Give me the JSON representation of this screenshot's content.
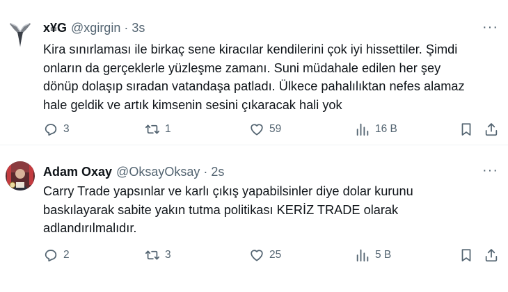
{
  "tweets": [
    {
      "name": "х¥G",
      "handle": "@xgirgin",
      "separator": "·",
      "time": "3s",
      "more": "···",
      "text": "Kira sınırlaması ile birkaç sene kiracılar kendilerini çok iyi hissettiler. Şimdi\nonların da gerçeklerle yüzleşme zamanı. Suni müdahale edilen her şey\ndönüp dolaşıp sıradan vatandaşa patladı. Ülkece pahalılıktan nefes alamaz\nhale geldik ve artık kimsenin sesini çıkaracak hali yok",
      "replies": "3",
      "retweets": "1",
      "likes": "59",
      "views": "16 B"
    },
    {
      "name": "Adam Oxay",
      "handle": "@OksayOksay",
      "separator": "·",
      "time": "2s",
      "more": "···",
      "text": "Carry Trade yapsınlar ve karlı çıkış yapabilsinler diye dolar kurunu\nbaskılayarak sabite yakın tutma politikası KERİZ TRADE olarak\nadlandırılmalıdır.",
      "replies": "2",
      "retweets": "3",
      "likes": "25",
      "views": "5 B"
    }
  ],
  "icons": {
    "reply": "reply-icon",
    "retweet": "retweet-icon",
    "like": "heart-icon",
    "views": "views-icon",
    "bookmark": "bookmark-icon",
    "share": "share-icon",
    "more": "more-icon"
  },
  "colors": {
    "text": "#0f1419",
    "secondary": "#536471",
    "divider": "#eff3f4"
  }
}
